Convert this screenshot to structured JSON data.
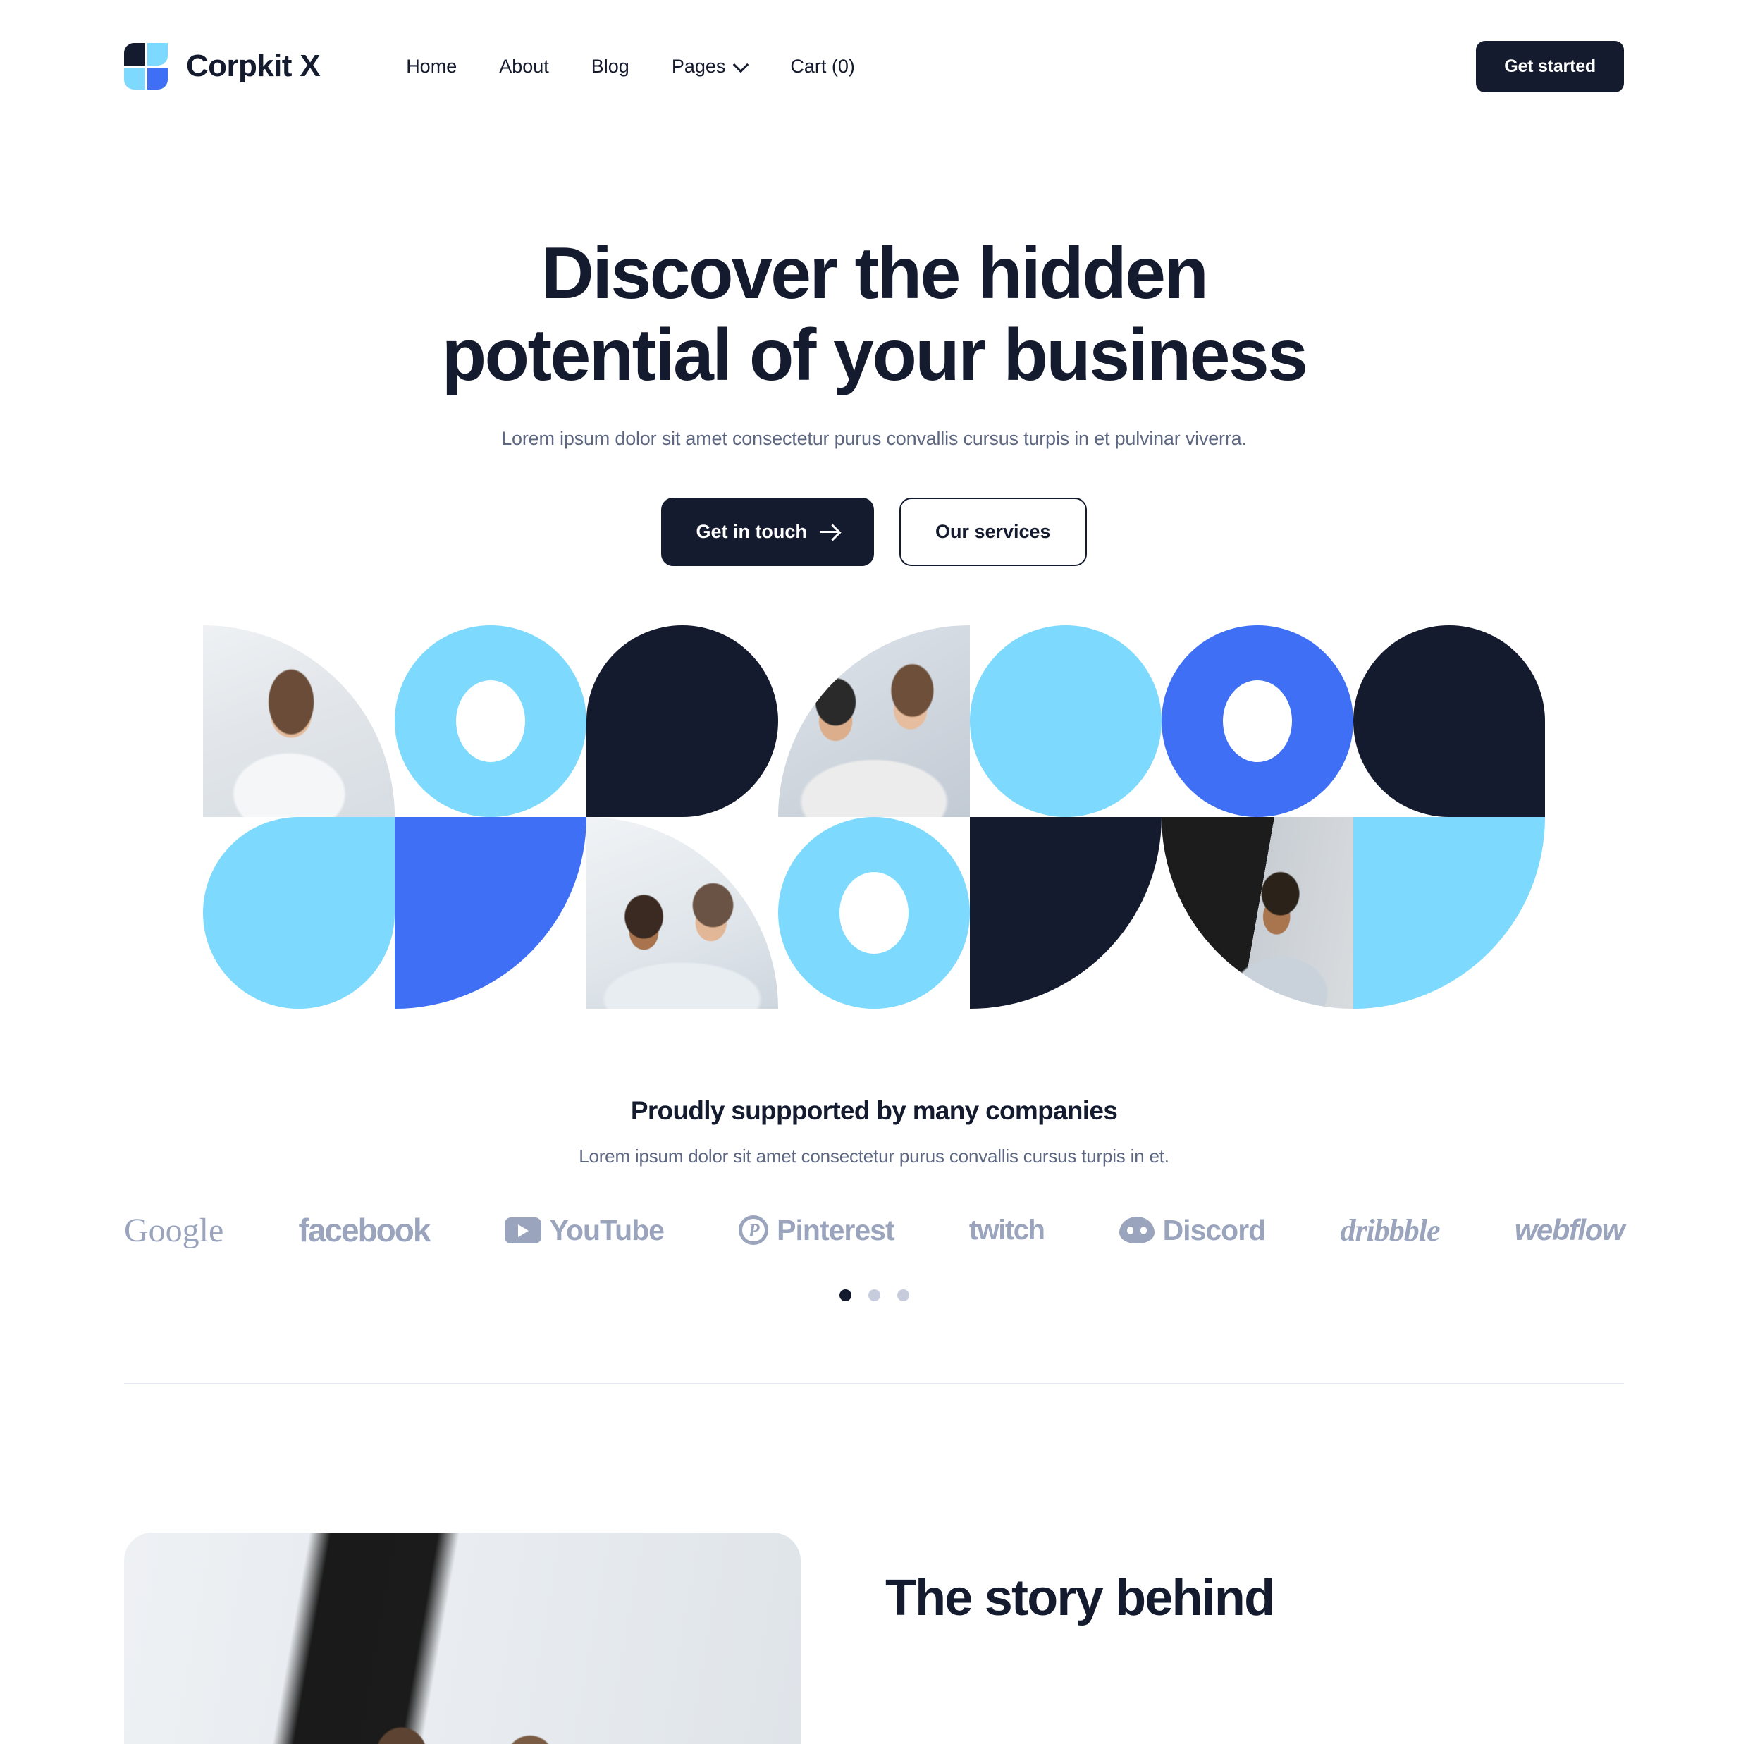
{
  "brand": {
    "name": "Corpkit X",
    "logo_icon": "corpkit-logo-mark"
  },
  "nav": {
    "items": [
      {
        "label": "Home",
        "has_dropdown": false
      },
      {
        "label": "About",
        "has_dropdown": false
      },
      {
        "label": "Blog",
        "has_dropdown": false
      },
      {
        "label": "Pages",
        "has_dropdown": true
      },
      {
        "label": "Cart (0)",
        "has_dropdown": false
      }
    ],
    "cta_label": "Get started"
  },
  "hero": {
    "title_line1": "Discover the hidden",
    "title_line2": "potential of your business",
    "subtitle": "Lorem ipsum dolor sit amet consectetur purus convallis cursus turpis in et pulvinar viverra.",
    "primary_cta": "Get in touch",
    "primary_cta_icon": "arrow-right-icon",
    "secondary_cta": "Our services"
  },
  "mosaic": {
    "cells": [
      {
        "kind": "photo",
        "shape": "rounded-top-right",
        "photo": "woman-writing-at-desk"
      },
      {
        "kind": "shape",
        "shape": "pill-ring",
        "color": "#7DD9FD"
      },
      {
        "kind": "shape",
        "shape": "rounded-all-but-bottom-left",
        "color": "#141B2E"
      },
      {
        "kind": "photo",
        "shape": "rounded-top-left",
        "photo": "two-colleagues-reviewing-tablet"
      },
      {
        "kind": "shape",
        "shape": "pill",
        "color": "#7DD9FD"
      },
      {
        "kind": "shape",
        "shape": "pill-ring",
        "color": "#3E6FF5"
      },
      {
        "kind": "shape",
        "shape": "rounded-all-but-bottom-right",
        "color": "#141B2E"
      },
      {
        "kind": "shape",
        "shape": "rounded-all-but-top-right",
        "color": "#7DD9FD"
      },
      {
        "kind": "shape",
        "shape": "rounded-bottom-right",
        "color": "#3E6FF5"
      },
      {
        "kind": "photo",
        "shape": "rounded-top-right",
        "photo": "two-coworkers-looking-down"
      },
      {
        "kind": "shape",
        "shape": "pill-ring",
        "color": "#7DD9FD"
      },
      {
        "kind": "shape",
        "shape": "rounded-bottom-right",
        "color": "#141B2E"
      },
      {
        "kind": "photo",
        "shape": "rounded-bottom-left",
        "photo": "woman-profile-portrait"
      },
      {
        "kind": "shape",
        "shape": "rounded-bottom-right",
        "color": "#7DD9FD"
      }
    ]
  },
  "partners": {
    "title": "Proudly suppported by many companies",
    "subtitle": "Lorem ipsum dolor sit amet consectetur purus convallis cursus turpis in et.",
    "logos": [
      {
        "name": "Google",
        "icon": ""
      },
      {
        "name": "facebook",
        "icon": ""
      },
      {
        "name": "YouTube",
        "icon": "youtube-play-icon"
      },
      {
        "name": "Pinterest",
        "icon": "pinterest-icon"
      },
      {
        "name": "twitch",
        "icon": ""
      },
      {
        "name": "Discord",
        "icon": "discord-icon"
      },
      {
        "name": "dribbble",
        "icon": ""
      },
      {
        "name": "webflow",
        "icon": ""
      }
    ],
    "carousel_dots": 3,
    "carousel_active_index": 0
  },
  "story": {
    "title": "The story behind",
    "image": "team-reviewing-charts-on-whiteboard"
  },
  "colors": {
    "navy": "#141B2E",
    "light_blue": "#7DD9FD",
    "blue": "#3E6FF5",
    "muted_text": "#5E6781",
    "logo_gray": "#9AA4BC",
    "divider": "#E6E9EF"
  }
}
